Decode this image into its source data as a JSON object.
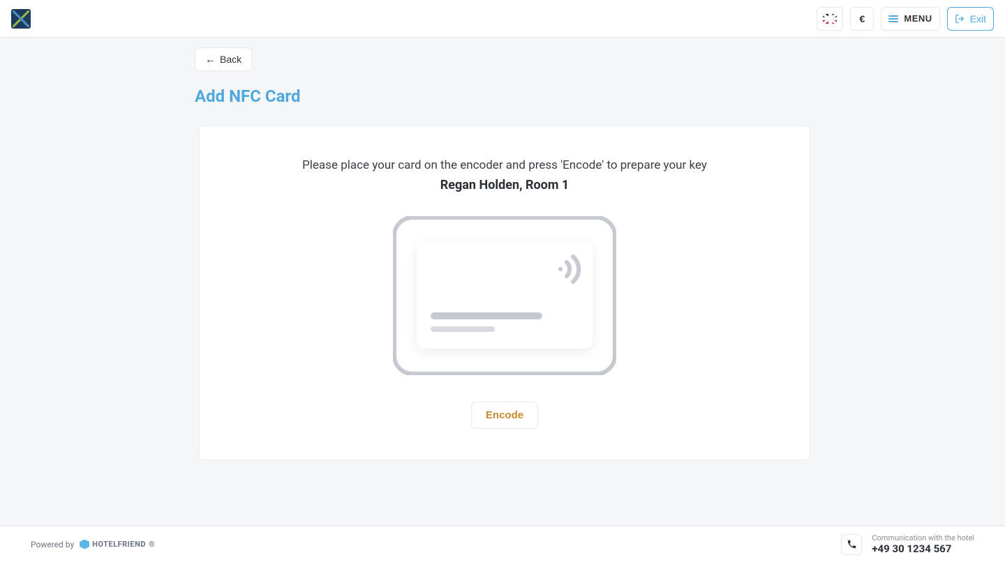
{
  "header": {
    "currency_symbol": "€",
    "menu_label": "MENU",
    "exit_label": "Exit"
  },
  "page": {
    "back_label": "Back",
    "title": "Add NFC Card"
  },
  "card": {
    "instruction": "Please place your card on the encoder and press 'Encode' to prepare your key",
    "guest_room": "Regan Holden, Room 1",
    "encode_label": "Encode"
  },
  "footer": {
    "powered_by": "Powered by",
    "brand": "HOTELFRIEND",
    "contact_label": "Communication with the hotel",
    "phone": "+49 30 1234 567"
  }
}
